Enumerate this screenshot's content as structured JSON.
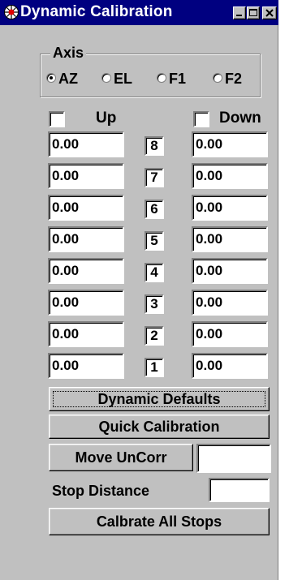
{
  "window": {
    "title": "Dynamic Calibration"
  },
  "axis": {
    "legend": "Axis",
    "options": [
      "AZ",
      "EL",
      "F1",
      "F2"
    ],
    "selected": "AZ"
  },
  "up": {
    "label": "Up",
    "checked": false
  },
  "down": {
    "label": "Down",
    "checked": false
  },
  "stops": [
    {
      "number": "8",
      "up": "0.00",
      "down": "0.00"
    },
    {
      "number": "7",
      "up": "0.00",
      "down": "0.00"
    },
    {
      "number": "6",
      "up": "0.00",
      "down": "0.00"
    },
    {
      "number": "5",
      "up": "0.00",
      "down": "0.00"
    },
    {
      "number": "4",
      "up": "0.00",
      "down": "0.00"
    },
    {
      "number": "3",
      "up": "0.00",
      "down": "0.00"
    },
    {
      "number": "2",
      "up": "0.00",
      "down": "0.00"
    },
    {
      "number": "1",
      "up": "0.00",
      "down": "0.00"
    }
  ],
  "buttons": {
    "dynamic_defaults": "Dynamic Defaults",
    "quick_calibration": "Quick Calibration",
    "move_uncorr": "Move UnCorr",
    "calibrate_all": "Calbrate All Stops"
  },
  "move_uncorr_value": "",
  "stop_distance": {
    "label": "Stop Distance",
    "value": ""
  }
}
